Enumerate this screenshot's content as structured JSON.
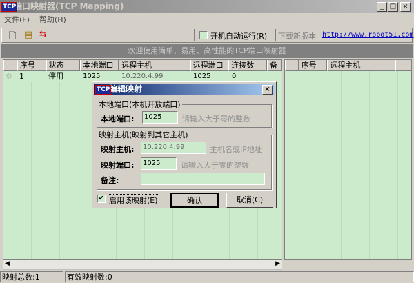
{
  "window": {
    "title": "端口映射器(TCP Mapping)",
    "icon_text": "TCP",
    "min": "_",
    "max": "□",
    "close": "×"
  },
  "menu": [
    "文件(F)",
    "帮助(H)"
  ],
  "toolbar": {
    "autorun_label": "开机自动运行(R)",
    "download_label": "下载新版本",
    "download_link": "http://www.robot51.com"
  },
  "banner": "欢迎使用简单、易用、高性能的TCP端口映射器",
  "left_list": {
    "columns": [
      "序号",
      "状态",
      "本地端口",
      "远程主机",
      "远程端口",
      "连接数",
      "备"
    ],
    "rows": [
      {
        "index": "1",
        "state": "停用",
        "local_port": "1025",
        "remote_host": "10.220.4.99",
        "remote_port": "1025",
        "connections": "0"
      }
    ]
  },
  "right_list": {
    "columns": [
      "序号",
      "远程主机"
    ]
  },
  "status": {
    "total": "映射总数:1",
    "active": "有效映射数:0"
  },
  "dialog": {
    "title": "编辑映射",
    "icon_text": "TCP",
    "close": "×",
    "local_group": "本地端口(本机开放端口)",
    "local_port_label": "本地端口:",
    "local_port_value": "1025",
    "local_port_hint": "请输入大于零的整数",
    "remote_group": "映射主机(映射到其它主机)",
    "host_label": "映射主机:",
    "host_value": "10.220.4.99",
    "host_hint": "主机名或IP地址",
    "port_label": "映射端口:",
    "port_value": "1025",
    "port_hint": "请输入大于零的整数",
    "note_label": "备注:",
    "note_value": "",
    "enable_label": "启用该映射(E)",
    "enable_checked": "✔",
    "ok": "确认",
    "cancel": "取消(C)"
  }
}
